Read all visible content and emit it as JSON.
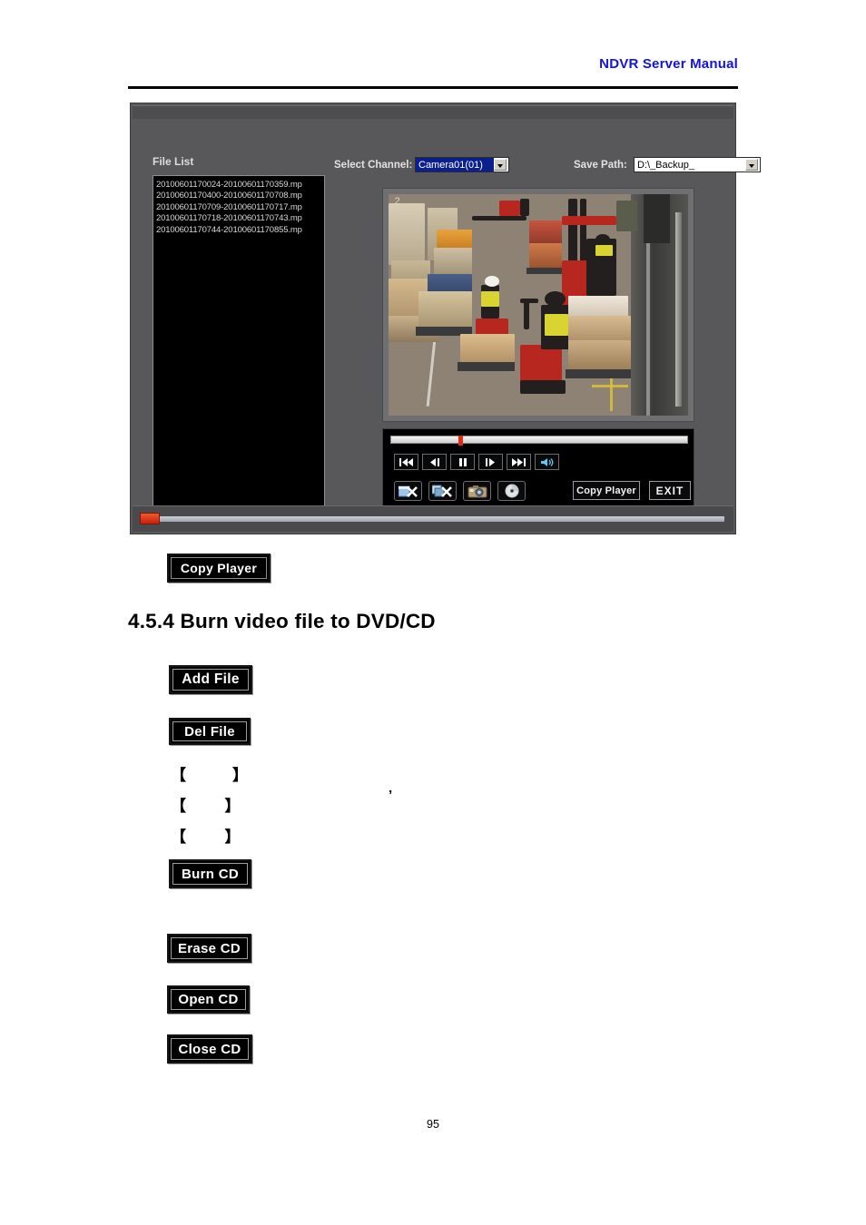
{
  "header": {
    "title": "NDVR Server Manual"
  },
  "screenshot": {
    "file_list": {
      "label": "File List",
      "items": [
        "20100601170024-20100601170359.mp",
        "20100601170400-20100601170708.mp",
        "20100601170709-20100601170717.mp",
        "20100601170718-20100601170743.mp",
        "20100601170744-20100601170855.mp"
      ]
    },
    "controls": {
      "select_channel_label": "Select Channel:",
      "select_channel_value": "Camera01(01)",
      "save_path_label": "Save Path:",
      "save_path_value": "D:\\_Backup_"
    },
    "video": {
      "overlay_number": "2"
    },
    "player": {
      "transport": [
        {
          "name": "skip-previous-icon",
          "title": "Previous"
        },
        {
          "name": "step-backward-icon",
          "title": "Step Back"
        },
        {
          "name": "pause-icon",
          "title": "Pause"
        },
        {
          "name": "step-forward-icon",
          "title": "Step Forward"
        },
        {
          "name": "skip-next-icon",
          "title": "Next"
        },
        {
          "name": "volume-icon",
          "title": "Volume"
        }
      ],
      "tools": [
        {
          "name": "delete-file-icon",
          "title": "Delete File"
        },
        {
          "name": "delete-all-icon",
          "title": "Delete All"
        },
        {
          "name": "snapshot-camera-icon",
          "title": "Snapshot"
        },
        {
          "name": "disc-icon",
          "title": "Burn Disc"
        }
      ],
      "copy_player_label": "Copy Player",
      "exit_label": "EXIT"
    }
  },
  "document": {
    "copy_player_button": "Copy Player",
    "section_heading": "4.5.4 Burn video file to DVD/CD",
    "add_file_button": "Add File",
    "del_file_button": "Del File",
    "bracket_lines": [
      "【            】",
      "【          】",
      "【          】"
    ],
    "stray_mark": "’",
    "burn_cd_button": "Burn CD",
    "erase_cd_button": "Erase CD",
    "open_cd_button": "Open CD",
    "close_cd_button": "Close CD",
    "page_number": "95"
  },
  "colors": {
    "header_blue": "#1111ee",
    "window_gray": "#58585a",
    "panel_black": "#000000",
    "selection_blue": "#0b1f8f",
    "slider_red": "#e02b12"
  }
}
